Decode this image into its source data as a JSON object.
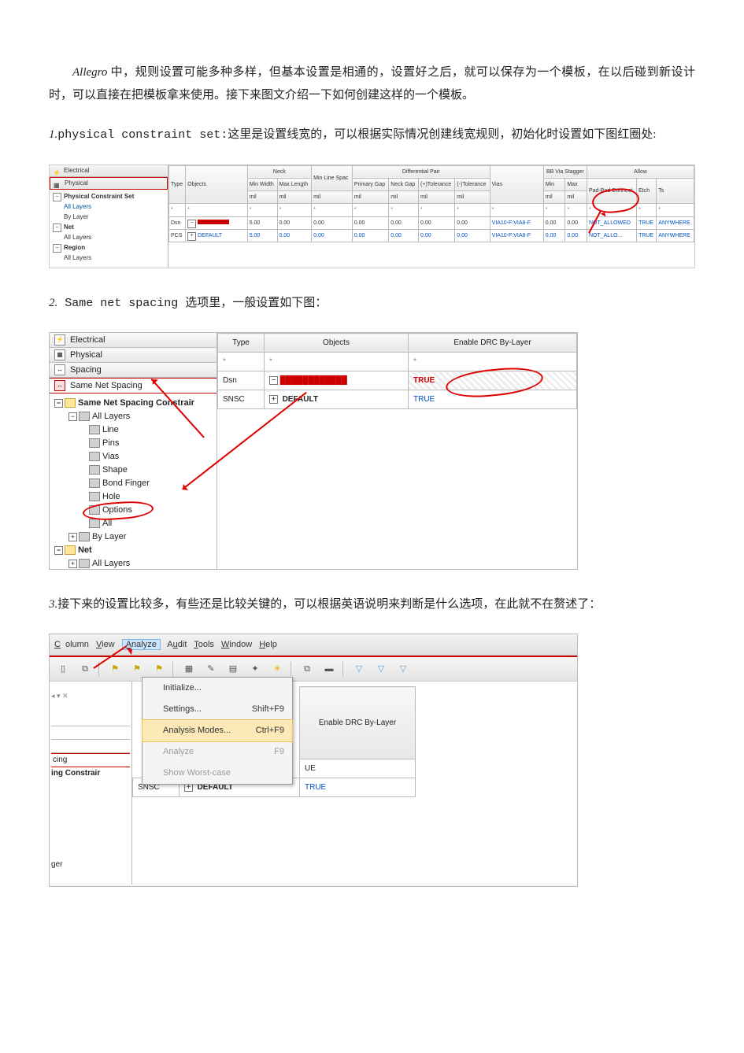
{
  "intro": {
    "line": "Allegro 中，规则设置可能多种多样，但基本设置是相通的，设置好之后，就可以保存为一个模板，在以后碰到新设计时，可以直接在把模板拿来使用。接下来图文介绍一下如何创建这样的一个模板。"
  },
  "sec1": {
    "num": "1.",
    "title": "physical constraint set:",
    "rest": "这里是设置线宽的，可以根据实际情况创建线宽规则，初始化时设置如下图红圈处:"
  },
  "sec2": {
    "num": "2.",
    "title": " Same net spacing ",
    "rest": "选项里，一般设置如下图："
  },
  "sec3": {
    "num": "3.",
    "rest": "接下来的设置比较多，有些还是比较关键的，可以根据英语说明来判断是什么选项，在此就不在赘述了："
  },
  "fig1": {
    "nav": {
      "electrical": "Electrical",
      "physical": "Physical"
    },
    "tree": {
      "pcs": "Physical Constraint Set",
      "all_layers": "All Layers",
      "by_layer": "By Layer",
      "net": "Net",
      "region": "Region"
    },
    "hdr": {
      "type": "Type",
      "objects": "Objects",
      "neck": "Neck",
      "min_width": "Min Width",
      "max_length": "Max Length",
      "min_line": "Min Line Spac",
      "diff": "Differential Pair",
      "primary_gap": "Primary Gap",
      "neck_gap": "Neck Gap",
      "ptol": "(+)Tolerance",
      "ntol": "(-)Tolerance",
      "vias": "Vias",
      "bbvia": "BB Via Stagger",
      "min": "Min",
      "max": "Max",
      "allow": "Allow",
      "padpad": "Pad-Pad Connect",
      "etch": "Etch",
      "ts": "Ts",
      "mil": "mil"
    },
    "rows": [
      {
        "type": "Dsn",
        "obj": "",
        "mw": "5.00",
        "ml": "0.00",
        "mls": "0.00",
        "pg": "0.00",
        "ng": "0.00",
        "pt": "0.00",
        "nt": "0.00",
        "via": "VIA10-F:VIA8-F",
        "min": "0.00",
        "max": "0.00",
        "pp": "NOT_ALLOWED",
        "etch": "TRUE",
        "ts": "ANYWHERE"
      },
      {
        "type": "PCS",
        "obj": "DEFAULT",
        "mw": "5.00",
        "ml": "0.00",
        "mls": "0.00",
        "pg": "0.00",
        "ng": "0.00",
        "pt": "0.00",
        "nt": "0.00",
        "via": "VIA10-F:VIA8-F",
        "min": "0.00",
        "max": "0.00",
        "pp": "NOT_ALLO...",
        "etch": "TRUE",
        "ts": "ANYWHERE"
      }
    ]
  },
  "fig2": {
    "tabs": {
      "electrical": "Electrical",
      "physical": "Physical",
      "spacing": "Spacing",
      "sns": "Same Net Spacing"
    },
    "tree": {
      "root": "Same Net Spacing Constrair",
      "all_layers": "All Layers",
      "line": "Line",
      "pins": "Pins",
      "vias": "Vias",
      "shape": "Shape",
      "bond": "Bond Finger",
      "hole": "Hole",
      "options": "Options",
      "all": "All",
      "by_layer": "By Layer",
      "net": "Net"
    },
    "tbl": {
      "type": "Type",
      "objects": "Objects",
      "enable": "Enable DRC By-Layer",
      "dsn": "Dsn",
      "snsc": "SNSC",
      "default": "DEFAULT",
      "true": "TRUE"
    }
  },
  "fig3": {
    "menus": {
      "column": "Column",
      "view": "View",
      "analyze": "Analyze",
      "audit": "Audit",
      "tools": "Tools",
      "window": "Window",
      "help": "Help"
    },
    "dropdown": {
      "initialize": "Initialize...",
      "settings": "Settings...",
      "settings_sc": "Shift+F9",
      "modes": "Analysis Modes...",
      "modes_sc": "Ctrl+F9",
      "analyze": "Analyze",
      "analyze_sc": "F9",
      "worst": "Show Worst-case"
    },
    "left": {
      "a": "",
      "cing": "cing",
      "constr": "ing Constrair",
      "ger": "ger"
    },
    "tbl": {
      "enable": "Enable DRC By-Layer",
      "ue": "UE",
      "snsc": "SNSC",
      "default": "DEFAULT",
      "true": "TRUE"
    },
    "tbicons": [
      "file-icon",
      "copy-icon",
      "sep",
      "back-icon",
      "sep",
      "flag1-icon",
      "flag2-icon",
      "flag3-icon",
      "sep",
      "grid1-icon",
      "edit-icon",
      "grid2-icon",
      "star-icon",
      "sun-icon",
      "sep",
      "win-icon",
      "bar-icon",
      "sep",
      "filter1-icon",
      "filter2-icon",
      "filter3-icon"
    ]
  }
}
